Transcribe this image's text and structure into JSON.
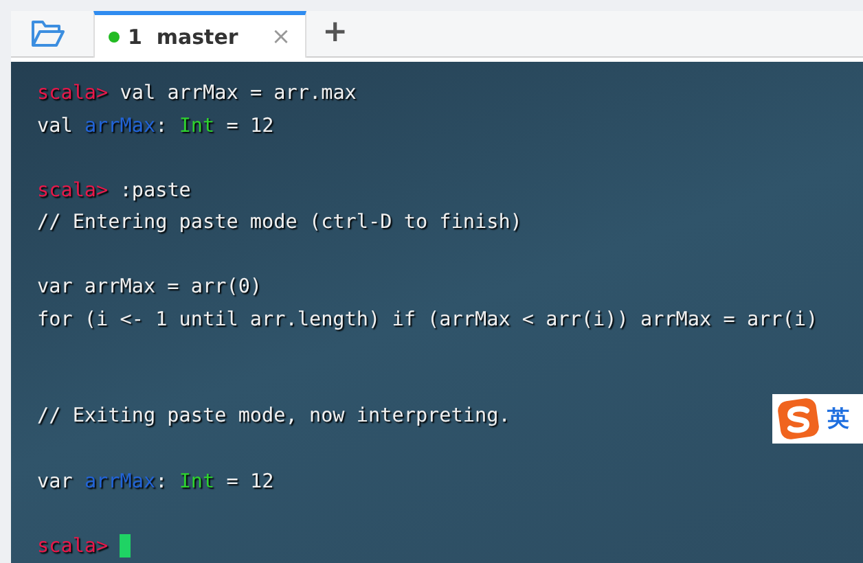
{
  "tabs": [
    {
      "label": "1  master",
      "selected": true,
      "color": "#22bb22",
      "close": "×"
    }
  ],
  "new_tab": "+",
  "terminal": {
    "lines": [
      {
        "kind": "text",
        "segments": [
          {
            "kind": "prompt",
            "text": "scala>"
          },
          {
            "kind": "plain",
            "text": " val arrMax = arr.max"
          }
        ]
      },
      {
        "kind": "text",
        "segments": [
          {
            "kind": "plain",
            "text": "val "
          },
          {
            "kind": "ident",
            "text": "arrMax"
          },
          {
            "kind": "plain",
            "text": ": "
          },
          {
            "kind": "type",
            "text": "Int"
          },
          {
            "kind": "plain",
            "text": " = 12"
          }
        ]
      },
      {
        "kind": "blank"
      },
      {
        "kind": "text",
        "segments": [
          {
            "kind": "prompt",
            "text": "scala>"
          },
          {
            "kind": "plain",
            "text": " :paste"
          }
        ]
      },
      {
        "kind": "text",
        "segments": [
          {
            "kind": "plain",
            "text": "// Entering paste mode (ctrl-D to finish)"
          }
        ]
      },
      {
        "kind": "blank"
      },
      {
        "kind": "text",
        "segments": [
          {
            "kind": "plain",
            "text": "var arrMax = arr(0)"
          }
        ]
      },
      {
        "kind": "text",
        "segments": [
          {
            "kind": "plain",
            "text": "for (i <- 1 until arr.length) if (arrMax < arr(i)) arrMax = arr(i)"
          }
        ]
      },
      {
        "kind": "blank"
      },
      {
        "kind": "blank"
      },
      {
        "kind": "text",
        "segments": [
          {
            "kind": "plain",
            "text": "// Exiting paste mode, now interpreting."
          }
        ]
      },
      {
        "kind": "blank"
      },
      {
        "kind": "text",
        "segments": [
          {
            "kind": "plain",
            "text": "var "
          },
          {
            "kind": "ident",
            "text": "arrMax"
          },
          {
            "kind": "plain",
            "text": ": "
          },
          {
            "kind": "type",
            "text": "Int"
          },
          {
            "kind": "plain",
            "text": " = 12"
          }
        ]
      },
      {
        "kind": "blank"
      },
      {
        "kind": "text",
        "segments": [
          {
            "kind": "prompt",
            "text": "scala>"
          },
          {
            "kind": "cursor"
          }
        ]
      }
    ]
  },
  "ime": {
    "mode": "英"
  }
}
